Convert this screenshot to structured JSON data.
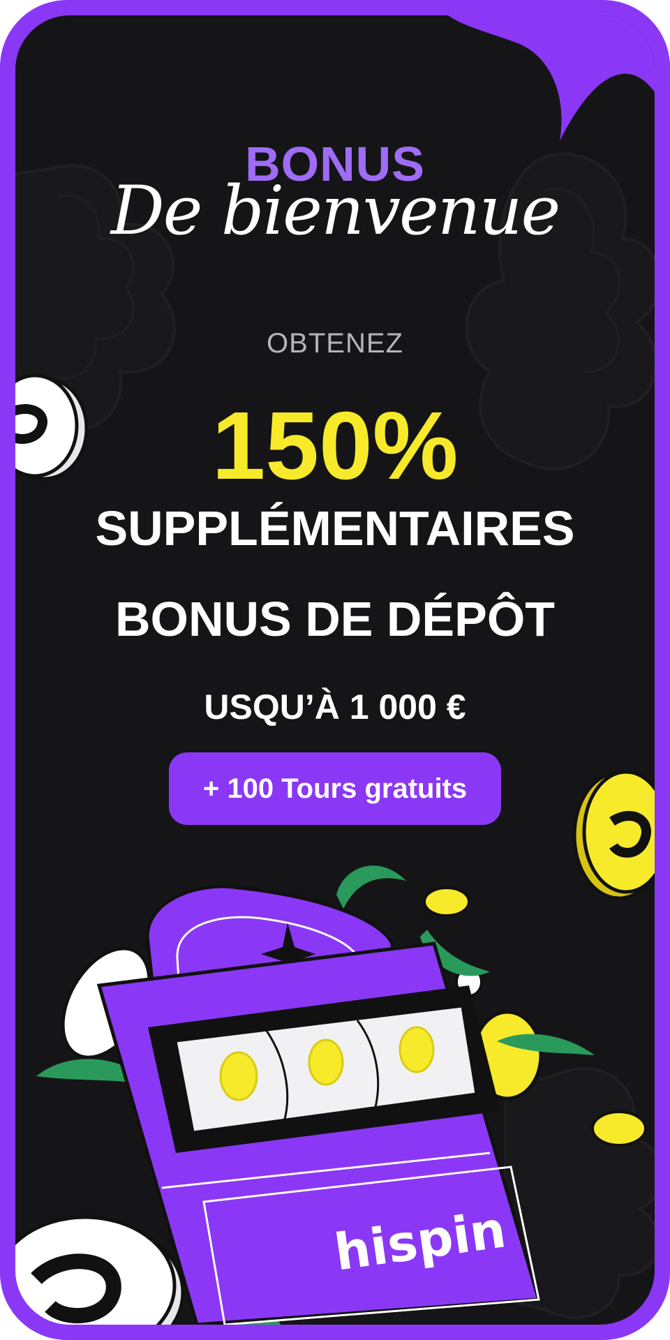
{
  "title": {
    "bonus": "BONUS",
    "script": "De bienvenue"
  },
  "offer": {
    "lead": "OBTENEZ",
    "percent": "150%",
    "line1": "SUPPLÉMENTAIRES",
    "line2": "BONUS DE DÉPÔT",
    "limit": "USQU’À 1 000 €",
    "free_spins": "+ 100 Tours gratuits"
  },
  "brand": {
    "logo_text": "hispin"
  },
  "colors": {
    "frame": "#8a38f5",
    "background": "#151517",
    "title_accent": "#9f6cf6",
    "highlight_yellow": "#f7ea2a",
    "text": "#ffffff",
    "muted_text": "#b5b5b8",
    "leaf_green": "#2a9a5c"
  }
}
